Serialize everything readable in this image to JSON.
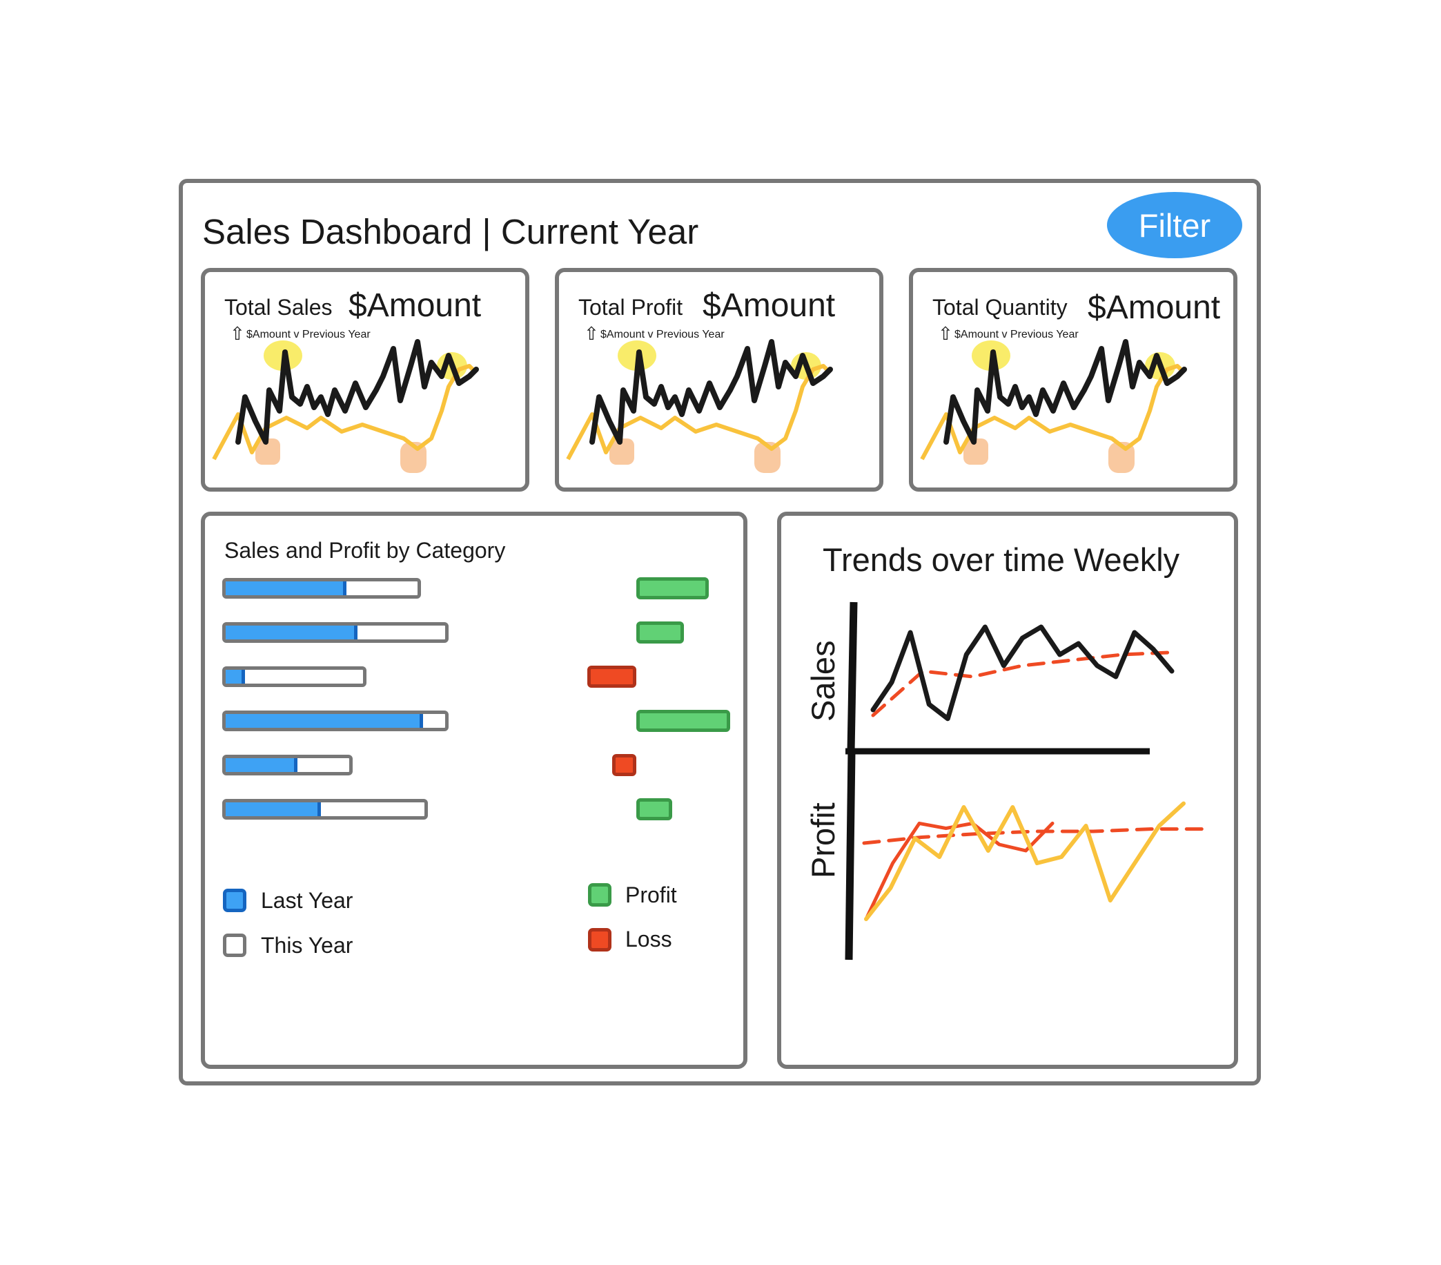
{
  "header": {
    "title": "Sales Dashboard | Current Year",
    "filter_label": "Filter"
  },
  "kpis": [
    {
      "label": "Total Sales",
      "value": "$Amount",
      "delta": "$Amount v Previous Year",
      "delta_icon": "up-arrow-icon"
    },
    {
      "label": "Total Profit",
      "value": "$Amount",
      "delta": "$Amount v Previous Year",
      "delta_icon": "up-arrow-icon"
    },
    {
      "label": "Total Quantity",
      "value": "$Amount",
      "delta": "$Amount v Previous Year",
      "delta_icon": "up-arrow-icon"
    }
  ],
  "category_panel": {
    "title": "Sales and Profit by Category",
    "legend": {
      "last_year": "Last Year",
      "this_year": "This Year",
      "profit": "Profit",
      "loss": "Loss"
    }
  },
  "trend_panel": {
    "title": "Trends over time Weekly",
    "sales_label": "Sales",
    "profit_label": "Profit"
  },
  "colors": {
    "accent": "#3a9df0",
    "last_year": "#3ea2f4",
    "profit": "#61d175",
    "loss": "#ef4a23",
    "sales_line": "#1a1a1a",
    "profit_line": "#f9c23c",
    "trend_dashed": "#ef4a23"
  },
  "chart_data": [
    {
      "type": "bar",
      "categories": [
        "",
        "",
        "",
        "",
        "",
        ""
      ],
      "series": [
        {
          "name": "Last Year",
          "values": [
            0.63,
            0.6,
            0.14,
            0.9,
            0.58,
            0.48
          ]
        },
        {
          "name": "This Year",
          "values": [
            1,
            1,
            1,
            1,
            1,
            1
          ]
        }
      ],
      "this_year_scale": [
        0.8,
        1.0,
        0.4,
        1.0,
        0.3,
        0.85
      ],
      "profit_loss": [
        {
          "kind": "profit",
          "magnitude": 0.77
        },
        {
          "kind": "profit",
          "magnitude": 0.51
        },
        {
          "kind": "loss",
          "magnitude": 0.52
        },
        {
          "kind": "profit",
          "magnitude": 1.0
        },
        {
          "kind": "loss",
          "magnitude": 0.26
        },
        {
          "kind": "profit",
          "magnitude": 0.38
        }
      ]
    },
    {
      "type": "line",
      "series": [
        {
          "name": "Sales",
          "values": [
            0.2,
            0.45,
            0.9,
            0.25,
            0.12,
            0.7,
            0.95,
            0.6,
            0.85,
            0.95,
            0.7,
            0.8,
            0.6,
            0.5,
            0.9,
            0.75,
            0.55
          ]
        },
        {
          "name": "Profit",
          "values": [
            0.05,
            0.3,
            0.7,
            0.55,
            0.95,
            0.6,
            0.95,
            0.5,
            0.55,
            0.8,
            0.2,
            0.5,
            0.8,
            0.98
          ]
        }
      ]
    }
  ]
}
